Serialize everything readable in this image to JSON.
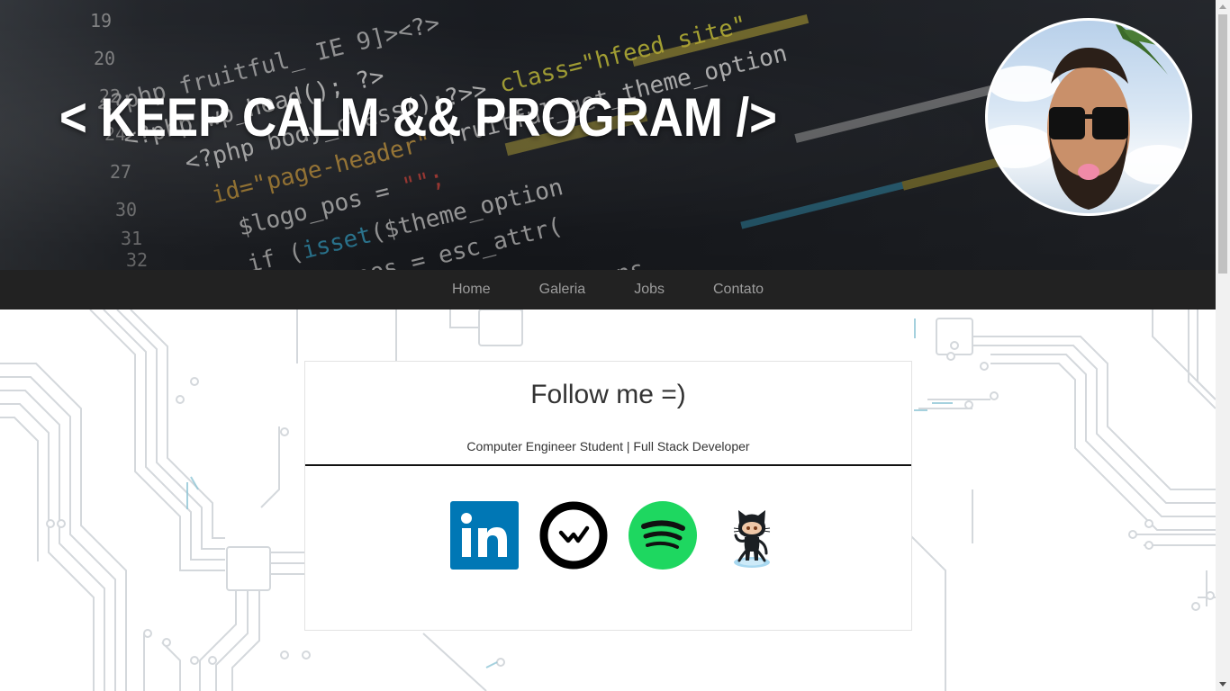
{
  "header": {
    "title": "< KEEP CALM && PROGRAM />",
    "avatar_icon": "profile-photo"
  },
  "nav": {
    "items": [
      {
        "label": "Home"
      },
      {
        "label": "Galeria"
      },
      {
        "label": "Jobs"
      },
      {
        "label": "Contato"
      }
    ]
  },
  "card": {
    "title": "Follow me =)",
    "subtitle": "Computer Engineer Student | Full Stack Developer",
    "social": [
      {
        "name": "linkedin-icon",
        "color": "#0077b5"
      },
      {
        "name": "wakatime-icon",
        "color": "#000000"
      },
      {
        "name": "spotify-icon",
        "color": "#1ed760"
      },
      {
        "name": "github-octocat-icon",
        "color": "#24292e"
      }
    ]
  },
  "colors": {
    "navbar": "#222222",
    "nav_text": "#9d9d9d",
    "hero_text": "#ffffff"
  }
}
